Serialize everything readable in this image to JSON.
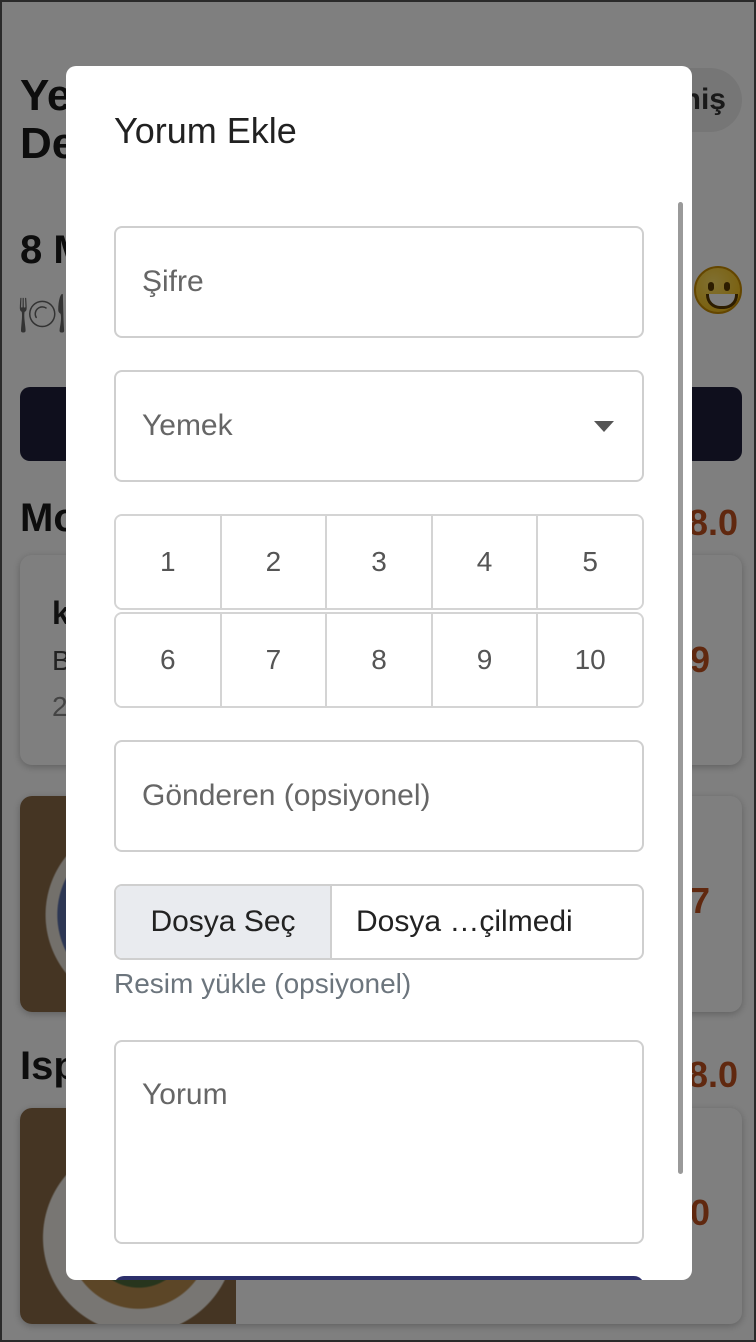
{
  "background": {
    "title": "Ye\nDe",
    "pill_label": "niş",
    "date": "8 M",
    "section_1": "Mo",
    "section_1_score": "8.0",
    "card_1": {
      "title": "k",
      "subtitle": "B",
      "meta": "2",
      "score": "9"
    },
    "card_2": {
      "score": "7"
    },
    "section_2": "Isp",
    "section_2_score": "8.0",
    "card_3": {
      "score": "0"
    },
    "accent_color": "#1e1f3a",
    "score_color": "#c0501e"
  },
  "modal": {
    "title": "Yorum Ekle",
    "password_placeholder": "Şifre",
    "meal_select_value": "Yemek",
    "rating_options_row1": [
      "1",
      "2",
      "3",
      "4",
      "5"
    ],
    "rating_options_row2": [
      "6",
      "7",
      "8",
      "9",
      "10"
    ],
    "sender_placeholder": "Gönderen (opsiyonel)",
    "file_button_label": "Dosya Seç",
    "file_status": "Dosya …çilmedi",
    "file_help": "Resim yükle (opsiyonel)",
    "comment_placeholder": "Yorum"
  }
}
